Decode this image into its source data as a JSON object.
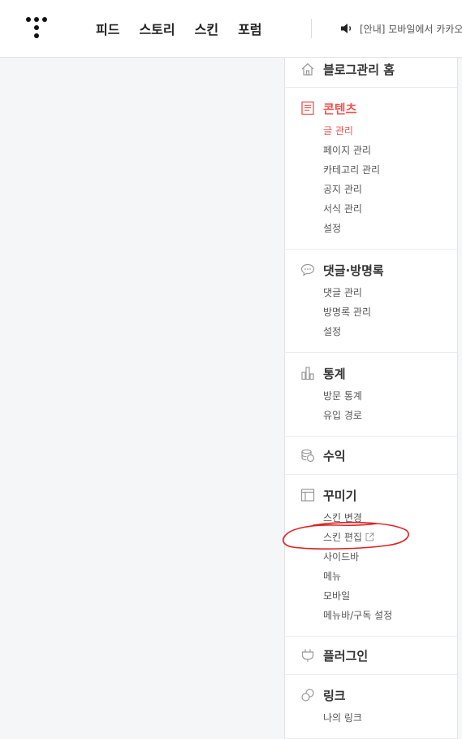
{
  "header": {
    "nav": [
      "피드",
      "스토리",
      "스킨",
      "포럼"
    ],
    "notice": "[안내] 모바일에서 카카오"
  },
  "sidebar": {
    "home": "블로그관리 홈",
    "contents": {
      "title": "콘텐츠",
      "items": [
        "글 관리",
        "페이지 관리",
        "카테고리 관리",
        "공지 관리",
        "서식 관리",
        "설정"
      ]
    },
    "comments": {
      "title": "댓글·방명록",
      "items": [
        "댓글 관리",
        "방명록 관리",
        "설정"
      ]
    },
    "stats": {
      "title": "통계",
      "items": [
        "방문 통계",
        "유입 경로"
      ]
    },
    "revenue": {
      "title": "수익"
    },
    "decorate": {
      "title": "꾸미기",
      "items": [
        "스킨 변경",
        "스킨 편집",
        "사이드바",
        "메뉴",
        "모바일",
        "메뉴바/구독 설정"
      ]
    },
    "plugin": {
      "title": "플러그인"
    },
    "link": {
      "title": "링크",
      "items": [
        "나의 링크"
      ]
    }
  },
  "colors": {
    "accent": "#ef5350",
    "annotation": "#e02020"
  }
}
